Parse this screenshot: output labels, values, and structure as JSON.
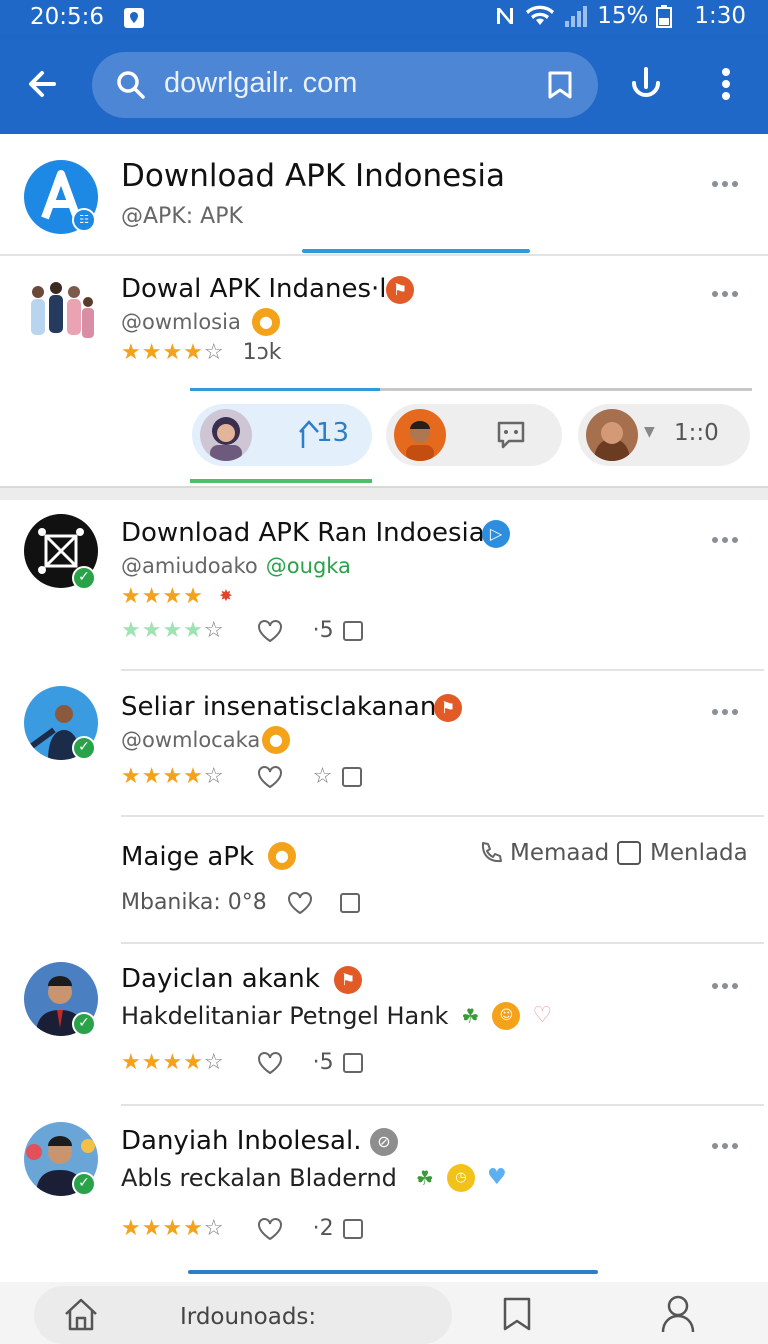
{
  "status": {
    "time": "20:5:6",
    "battery": "15%",
    "clock": "1:30"
  },
  "browser": {
    "url": "dowrlgailr. com"
  },
  "header_card": {
    "title": "Download APK Indonesia",
    "handle": "@APK: APK"
  },
  "profile_card": {
    "title": "Dowal APK Indanes·l",
    "handle": "@owmlosia",
    "rating_count": "1ɔk",
    "chips": [
      {
        "label": "13"
      },
      {
        "label": ""
      },
      {
        "label": "1::0"
      }
    ]
  },
  "feed": [
    {
      "title": "Download APK Ran Indoesia",
      "handle": "@amiudoako",
      "handle2": "@ougka",
      "count": "·5",
      "rating": 4
    },
    {
      "title": "Seliar insenatisclakanan",
      "handle": "@owmlocaka",
      "rating": 4
    },
    {
      "title": "Maige aPk",
      "meta": "Mbanika: 0°8",
      "action1": "Memaad",
      "action2": "Menlada"
    },
    {
      "title": "Dayiclan akank",
      "subtitle": "Hakdelitaniar Petngel Hank",
      "count": "·5",
      "rating": 4
    },
    {
      "title": "Danyiah Inbolesal.",
      "subtitle": "Abls reckalan Bladernd",
      "count": "·2",
      "rating": 4
    }
  ],
  "bottom_nav": {
    "label": "Irdounoads:"
  },
  "colors": {
    "primary": "#1f68c7",
    "star": "#f4a11b",
    "verified": "#2aa24a",
    "accent": "#2d9bd8"
  }
}
